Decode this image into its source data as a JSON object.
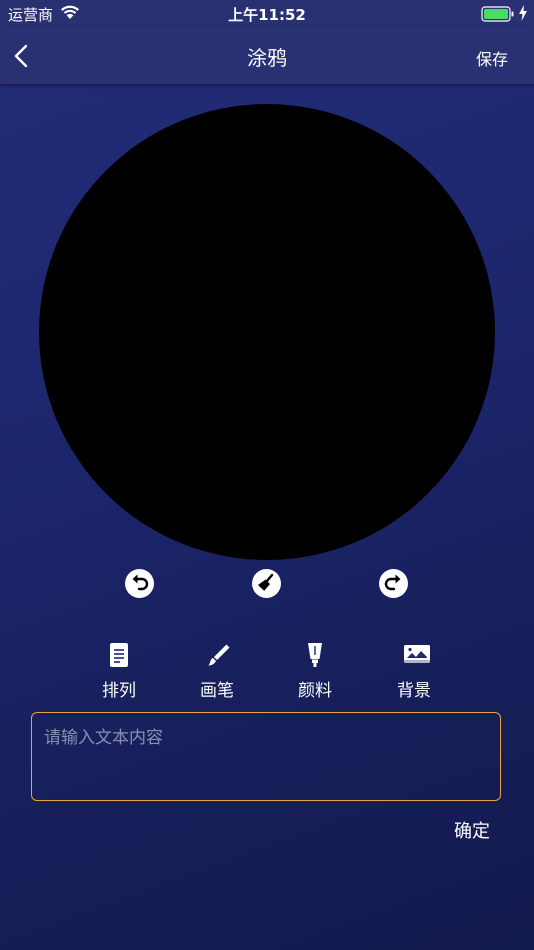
{
  "status_bar": {
    "carrier": "运营商",
    "time": "上午11:52",
    "battery_color": "#4cd964"
  },
  "nav": {
    "back_icon": "chevron-left-icon",
    "title": "涂鸦",
    "save_label": "保存"
  },
  "canvas": {
    "background_color": "#000000"
  },
  "tools": [
    {
      "name": "undo",
      "icon": "undo-icon"
    },
    {
      "name": "clear",
      "icon": "broom-icon"
    },
    {
      "name": "redo",
      "icon": "redo-icon"
    }
  ],
  "tabs": [
    {
      "label": "排列",
      "icon": "document-icon"
    },
    {
      "label": "画笔",
      "icon": "brush-icon"
    },
    {
      "label": "颜料",
      "icon": "paint-tube-icon"
    },
    {
      "label": "背景",
      "icon": "image-icon"
    }
  ],
  "text_input": {
    "placeholder": "请输入文本内容",
    "value": "",
    "border_color": "#e8a33c"
  },
  "confirm_label": "确定"
}
